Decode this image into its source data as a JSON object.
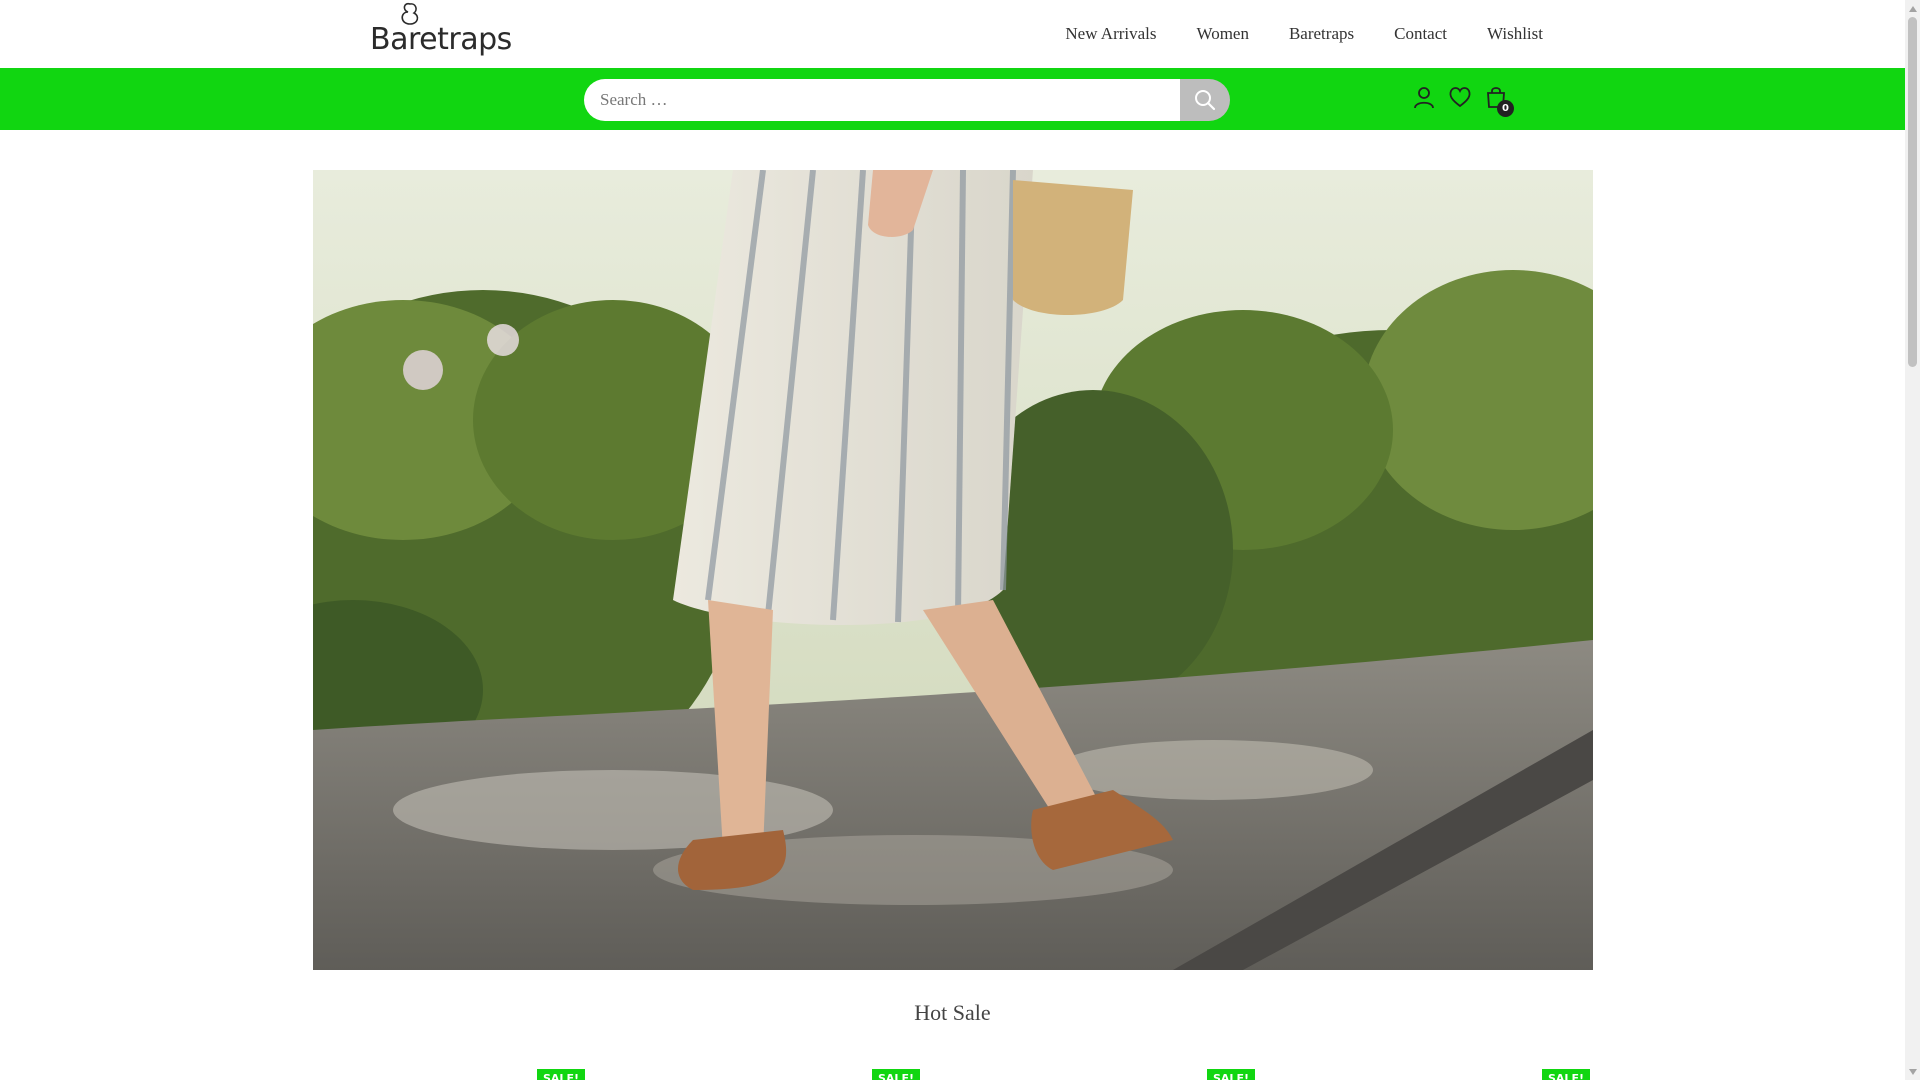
{
  "brand": {
    "name": "Baretraps",
    "icon": "baretraps-logo-icon"
  },
  "nav": {
    "items": [
      {
        "label": "New Arrivals"
      },
      {
        "label": "Women"
      },
      {
        "label": "Baretraps"
      },
      {
        "label": "Contact"
      },
      {
        "label": "Wishlist"
      }
    ]
  },
  "search": {
    "placeholder": "Search …",
    "value": "",
    "button_icon": "search-icon"
  },
  "header_icons": {
    "account": "user-icon",
    "wishlist": "heart-icon",
    "cart": "shopping-bag-icon",
    "cart_count": "0"
  },
  "hero": {
    "alt_subject": "woman walking in tan sandals and striped dress"
  },
  "sections": {
    "hot_sale_title": "Hot Sale"
  },
  "badges": {
    "sale_label": "SALE!"
  },
  "colors": {
    "accent_green": "#11d611",
    "search_button": "#bdbdbd",
    "cart_badge": "#222222"
  }
}
